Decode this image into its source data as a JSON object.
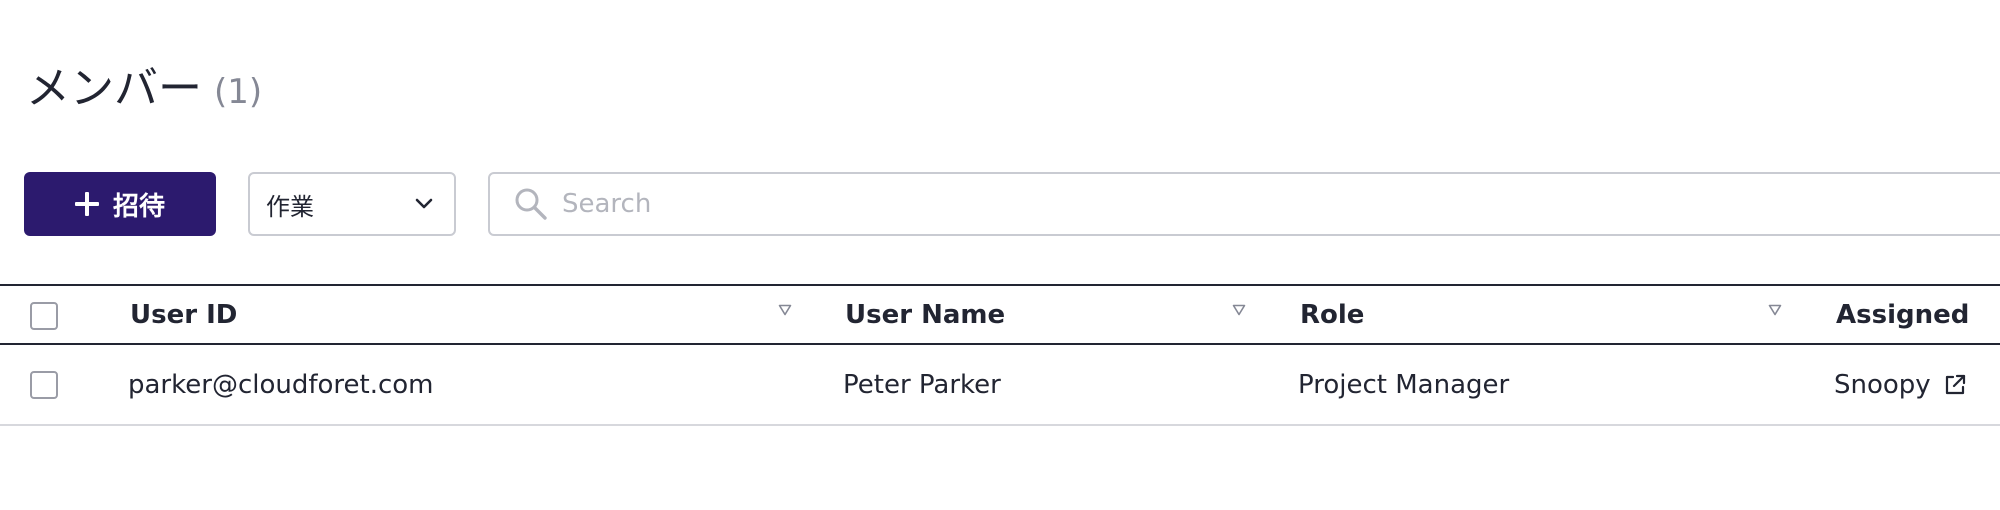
{
  "header": {
    "title": "メンバー",
    "count": "(1)"
  },
  "toolbar": {
    "invite_label": "招待",
    "filter_select": {
      "selected": "作業"
    },
    "search": {
      "placeholder": "Search",
      "value": ""
    }
  },
  "table": {
    "columns": [
      "User ID",
      "User Name",
      "Role",
      "Assigned"
    ],
    "rows": [
      {
        "user_id": "parker@cloudforet.com",
        "user_name": "Peter Parker",
        "role": "Project Manager",
        "assigned": "Snoopy"
      }
    ]
  },
  "colors": {
    "primary": "#2c1a6e",
    "text": "#222532",
    "muted": "#858895",
    "border": "#c9cbd2",
    "placeholder": "#b3b5bd"
  },
  "icons": {
    "invite": "plus-icon",
    "select": "chevron-down-icon",
    "search": "search-icon",
    "sort": "sort-triangle-icon",
    "assigned_link": "external-link-icon"
  }
}
